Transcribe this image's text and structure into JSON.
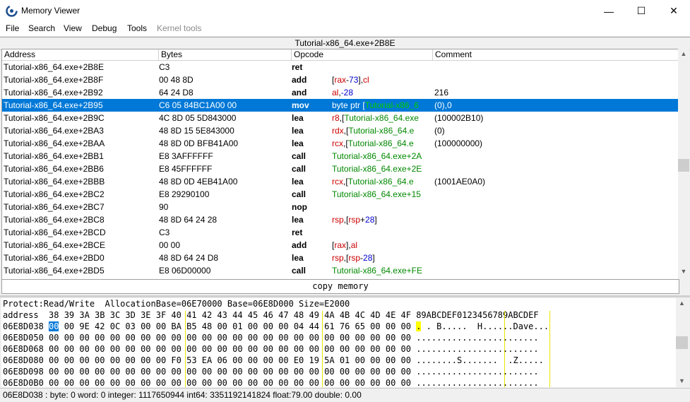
{
  "window": {
    "title": "Memory Viewer",
    "btn_min": "—",
    "btn_max": "☐",
    "btn_close": "✕"
  },
  "menu": [
    "File",
    "Search",
    "View",
    "Debug",
    "Tools",
    "Kernel tools"
  ],
  "disasm": {
    "header": "Tutorial-x86_64.exe+2B8E",
    "columns": {
      "address": "Address",
      "bytes": "Bytes",
      "opcode": "Opcode",
      "comment": "Comment"
    },
    "rows": [
      {
        "addr": "Tutorial-x86_64.exe+2B8E",
        "bytes": "C3",
        "op": "ret",
        "args": [],
        "comment": ""
      },
      {
        "addr": "Tutorial-x86_64.exe+2B8F",
        "bytes": "00 48 8D",
        "op": "add",
        "args": [
          {
            "t": "[",
            "c": "#000"
          },
          {
            "t": "rax",
            "c": "#cc0000"
          },
          {
            "t": "-",
            "c": "#000"
          },
          {
            "t": "73",
            "c": "#0000cc"
          },
          {
            "t": "],",
            "c": "#000"
          },
          {
            "t": "cl",
            "c": "#cc0000"
          }
        ],
        "comment": ""
      },
      {
        "addr": "Tutorial-x86_64.exe+2B92",
        "bytes": "64 24 D8",
        "op": "and",
        "args": [
          {
            "t": "al",
            "c": "#cc0000"
          },
          {
            "t": ",",
            "c": "#000"
          },
          {
            "t": "-28",
            "c": "#0000cc"
          }
        ],
        "comment": "216"
      },
      {
        "addr": "Tutorial-x86_64.exe+2B95",
        "bytes": "C6 05 84BC1A00 00",
        "op": "mov",
        "args": [
          {
            "t": "byte ptr [",
            "c": "#fff"
          },
          {
            "t": "Tutorial-x86_6",
            "c": "#00cc00"
          }
        ],
        "comment": "(0),0"
      },
      {
        "addr": "Tutorial-x86_64.exe+2B9C",
        "bytes": "4C 8D 05 5D843000",
        "op": "lea",
        "args": [
          {
            "t": "r8",
            "c": "#cc0000"
          },
          {
            "t": ",[",
            "c": "#000"
          },
          {
            "t": "Tutorial-x86_64.exe",
            "c": "#008800"
          }
        ],
        "comment": "(100002B10)"
      },
      {
        "addr": "Tutorial-x86_64.exe+2BA3",
        "bytes": "48 8D 15 5E843000",
        "op": "lea",
        "args": [
          {
            "t": "rdx",
            "c": "#cc0000"
          },
          {
            "t": ",[",
            "c": "#000"
          },
          {
            "t": "Tutorial-x86_64.e",
            "c": "#008800"
          }
        ],
        "comment": "(0)"
      },
      {
        "addr": "Tutorial-x86_64.exe+2BAA",
        "bytes": "48 8D 0D BFB41A00",
        "op": "lea",
        "args": [
          {
            "t": "rcx",
            "c": "#cc0000"
          },
          {
            "t": ",[",
            "c": "#000"
          },
          {
            "t": "Tutorial-x86_64.e",
            "c": "#008800"
          }
        ],
        "comment": "(100000000)"
      },
      {
        "addr": "Tutorial-x86_64.exe+2BB1",
        "bytes": "E8 3AFFFFFF",
        "op": "call",
        "args": [
          {
            "t": "Tutorial-x86_64.exe+2A",
            "c": "#008800"
          }
        ],
        "comment": ""
      },
      {
        "addr": "Tutorial-x86_64.exe+2BB6",
        "bytes": "E8 45FFFFFF",
        "op": "call",
        "args": [
          {
            "t": "Tutorial-x86_64.exe+2E",
            "c": "#008800"
          }
        ],
        "comment": ""
      },
      {
        "addr": "Tutorial-x86_64.exe+2BBB",
        "bytes": "48 8D 0D 4EB41A00",
        "op": "lea",
        "args": [
          {
            "t": "rcx",
            "c": "#cc0000"
          },
          {
            "t": ",[",
            "c": "#000"
          },
          {
            "t": "Tutorial-x86_64.e",
            "c": "#008800"
          }
        ],
        "comment": "(1001AE0A0)"
      },
      {
        "addr": "Tutorial-x86_64.exe+2BC2",
        "bytes": "E8 29290100",
        "op": "call",
        "args": [
          {
            "t": "Tutorial-x86_64.exe+15",
            "c": "#008800"
          }
        ],
        "comment": ""
      },
      {
        "addr": "Tutorial-x86_64.exe+2BC7",
        "bytes": "90",
        "op": "nop",
        "args": [],
        "comment": ""
      },
      {
        "addr": "Tutorial-x86_64.exe+2BC8",
        "bytes": "48 8D 64 24 28",
        "op": "lea",
        "args": [
          {
            "t": "rsp",
            "c": "#cc0000"
          },
          {
            "t": ",[",
            "c": "#000"
          },
          {
            "t": "rsp",
            "c": "#cc0000"
          },
          {
            "t": "+",
            "c": "#000"
          },
          {
            "t": "28",
            "c": "#0000cc"
          },
          {
            "t": "]",
            "c": "#000"
          }
        ],
        "comment": ""
      },
      {
        "addr": "Tutorial-x86_64.exe+2BCD",
        "bytes": "C3",
        "op": "ret",
        "args": [],
        "comment": ""
      },
      {
        "addr": "Tutorial-x86_64.exe+2BCE",
        "bytes": "00 00",
        "op": "add",
        "args": [
          {
            "t": "[",
            "c": "#000"
          },
          {
            "t": "rax",
            "c": "#cc0000"
          },
          {
            "t": "],",
            "c": "#000"
          },
          {
            "t": "al",
            "c": "#cc0000"
          }
        ],
        "comment": ""
      },
      {
        "addr": "Tutorial-x86_64.exe+2BD0",
        "bytes": "48 8D 64 24 D8",
        "op": "lea",
        "args": [
          {
            "t": "rsp",
            "c": "#cc0000"
          },
          {
            "t": ",[",
            "c": "#000"
          },
          {
            "t": "rsp",
            "c": "#cc0000"
          },
          {
            "t": "-",
            "c": "#000"
          },
          {
            "t": "28",
            "c": "#0000cc"
          },
          {
            "t": "]",
            "c": "#000"
          }
        ],
        "comment": ""
      },
      {
        "addr": "Tutorial-x86_64.exe+2BD5",
        "bytes": "E8 06D00000",
        "op": "call",
        "args": [
          {
            "t": "Tutorial-x86_64.exe+FE",
            "c": "#008800"
          }
        ],
        "comment": ""
      }
    ],
    "selected_index": 3
  },
  "copy_memory_label": "copy memory",
  "hex": {
    "info": "Protect:Read/Write  AllocationBase=06E70000 Base=06E8D000 Size=E2000",
    "header": "address  38 39 3A 3B 3C 3D 3E 3F 40 41 42 43 44 45 46 47 48 49 4A 4B 4C 4D 4E 4F 89ABCDEF0123456789ABCDEF",
    "rows": [
      {
        "addr": "06E8D038",
        "bytes": "00 00 9E 42 0C 03 00 00 BA B5 48 00 01 00 00 00 04 44 61 76 65 00 00 00",
        "ascii": ". . B.....  H......Dave..."
      },
      {
        "addr": "06E8D050",
        "bytes": "00 00 00 00 00 00 00 00 00 00 00 00 00 00 00 00 00 00 00 00 00 00 00 00",
        "ascii": "........................"
      },
      {
        "addr": "06E8D068",
        "bytes": "00 00 00 00 00 00 00 00 00 00 00 00 00 00 00 00 00 00 00 00 00 00 00 00",
        "ascii": "........................"
      },
      {
        "addr": "06E8D080",
        "bytes": "00 00 00 00 00 00 00 00 F0 53 EA 06 00 00 00 00 E0 19 5A 01 00 00 00 00",
        "ascii": "........S.......  .Z....."
      },
      {
        "addr": "06E8D098",
        "bytes": "00 00 00 00 00 00 00 00 00 00 00 00 00 00 00 00 00 00 00 00 00 00 00 00",
        "ascii": "........................"
      },
      {
        "addr": "06E8D0B0",
        "bytes": "00 00 00 00 00 00 00 00 00 00 00 00 00 00 00 00 00 00 00 00 00 00 00 00",
        "ascii": "........................"
      }
    ]
  },
  "status": "06E8D038 : byte: 0 word: 0 integer: 1117650944 int64: 3351192141824 float:79.00 double: 0.00"
}
